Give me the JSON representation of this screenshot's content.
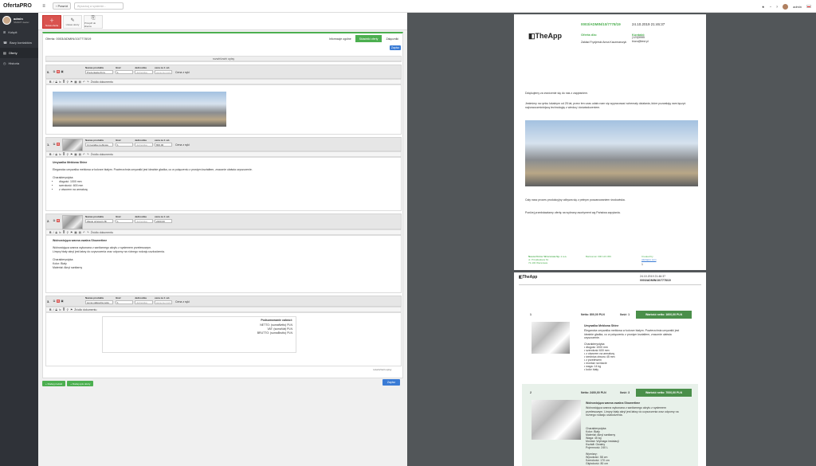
{
  "app": {
    "brand": "OfertaPRO",
    "back_label": "Powrót",
    "search_placeholder": "Wyszukaj w systemie...",
    "user_name": "admin"
  },
  "sidebar": {
    "user_name": "admin",
    "user_role": "SMART dealer",
    "items": [
      {
        "icon": "⊞",
        "label": "Kokpit"
      },
      {
        "icon": "☎",
        "label": "Bazy kontaktów"
      },
      {
        "icon": "▤",
        "label": "Oferty"
      },
      {
        "icon": "◷",
        "label": "Historia"
      }
    ]
  },
  "toolbar": {
    "buttons": [
      {
        "icon": "＋",
        "label": "Nowa oferta"
      },
      {
        "icon": "✎",
        "label": "Ustaw oferty"
      },
      {
        "icon": "⎘",
        "label": "Przejdź do klienta"
      }
    ]
  },
  "offer": {
    "header": "Oferta: 0003/ADMIN/10/7778/19",
    "tabs": [
      "Informacje ogólne",
      "Składniki oferty",
      "Załączniki"
    ],
    "save_label": "Zapisz",
    "rozwin_label": "rozwiń/zwiń opisy",
    "cena_label": "Cena z ręki",
    "field_labels": {
      "name": "Nazwa produktu",
      "qty": "Ilość",
      "unit": "Jednostka",
      "price": "cena za 1 szt."
    },
    "unit_placeholder": "Jednostka",
    "price_placeholder": "cena za 1 szt.",
    "source_label": "Źródło dokumentu",
    "products": [
      {
        "num": "0.",
        "name": "Prezentacja firmy",
        "qty": "1",
        "unit": "",
        "price": ""
      },
      {
        "num": "1.",
        "name": "Umywalka meblowa",
        "qty": "1",
        "unit": "",
        "price": "800,00"
      },
      {
        "num": "2.",
        "name": "Zlecaj grzewczy Bi",
        "qty": "1",
        "unit": "",
        "price": "2400,00"
      },
      {
        "num": "3.",
        "name": "suma całkowita netto",
        "qty": "1",
        "unit": "",
        "price": ""
      }
    ],
    "ed2": {
      "title": "Umywalka Meblowa Shine",
      "p": "Elegancka umywalka meblowa w kolorze białym. Powierzchnia umywalki jest idealnie gładka, co w połączeniu z prostym kształtem, znacznie ułatwia czyszczenie.",
      "char": "Charakterystyka:",
      "items": [
        "długość: 1000 mm",
        "szerokość: 600 mm",
        "z otworem na armaturę"
      ]
    },
    "ed3": {
      "title": "Wolnostojąca wanna owalna Showertime",
      "p1": "Wolnostojąca wanna wykonana z sanitarnego akrylu z systemem przelewowym.",
      "p2": "Limpry biały akryl jest łatwy do czyszczenia oraz odporny na różnego rodzaju uszkodzenia.",
      "c1": "Charakterystyka:",
      "c2": "Kolor: Biały",
      "c3": "Materiał: Akryl sanitarny"
    },
    "summary": {
      "title": "Podsumowanie całości:",
      "netto": "NETTO: (sumaNetto) PLN",
      "vat": "VAT: (sumaVat) PLN",
      "brutto": "BRUTTO: (sumaBrutto) PLN"
    },
    "add_product": "+ Dodaj produkt",
    "add_from_offer": "+ Dodaj opis oferty",
    "rozwin_bottom": "rozwiń/zwiń opisy",
    "save_bottom": "Zapisz"
  },
  "preview": {
    "number": "0003/ADMIN/10/7778/19",
    "date": "24.10.2019 21:46:37",
    "logo": "TheApp",
    "from_label": "Oferta dla:",
    "from_val": "Zakład Fryzjerski Anna Kaczmarczyk",
    "contact_label": "Kontakt:",
    "contact_phone": "(123)5555",
    "contact_email": "biuro@test.pl",
    "thanks": "Dziękujemy za zwrócenie się do nas z zapytaniem.",
    "intro": "Jesteśmy na rynku lokalnym od 25 lat, przez ten czas udało nam się wypracować schematy działania, które pozwalają nam łączyć najnowocześniejszą technologię z wiedzą i doświadczeniem.",
    "p1": "Cały nasz proces produkcyjny odbywa się z pełnym poszanowaniem środowiska.",
    "p2": "Poniżej przedstawiamy ofertę na wybrany asortyment wg Państwa zapytania.",
    "footer": {
      "c1a": "Nasza Firma: Wzorcowa Sp. z o.o.",
      "c1b": "ul. Przykładowa 61",
      "c1c": "72-100 Warszawa",
      "c2": "Bankomat: 000 123 456",
      "c3a": "Created by",
      "c3b": "ofertapro.com",
      "page": "1"
    },
    "p2date": "24.10.2019 21:46:37",
    "p2num": "0003/ADMIN/10/7778/19",
    "items": [
      {
        "n": "1",
        "netto": "Netto: 800,00 PLN",
        "ilosc": "Ilość: 1",
        "wart": "Wartość netto: 1600,00 PLN",
        "title": "Umywalka Meblowa Shine",
        "desc": "Elegancka umywalka meblowa w kolorze białym. Powierzchnia umywalki jest idealnie gładka, co w połączeniu z prostym kształtem, znacznie ułatwia czyszczenie.",
        "specs": [
          "Charakterystyka:",
          "• długość 1000 mm",
          "• szerokość 600 mm",
          "• z otworem na armaturę",
          "• średnica otworu 45 mm",
          "• z przelewem",
          "• montaż na blacie",
          "• waga: 14 kg",
          "• kolor biały"
        ]
      },
      {
        "n": "2",
        "netto": "Netto: 2400,00 PLN",
        "ilosc": "Ilość: 3",
        "wart": "Wartość netto: 7000,00 PLN",
        "title": "Wolnostojąca wanna owalna Showertime",
        "desc": "Wolnostojąca wanna wykonana z sanitarnego akrylu z systemem przelewowym. Limpry biały akryl jest łatwy do czyszczenia oraz odporny na różnego rodzaju uszkodzenia.",
        "specs": [
          "Charakterystyka:",
          "Kolor: Biały",
          "Materiał: Akryl sanitarny",
          "Waga: 45 kg",
          "Montaż: Wymaga instalacji",
          "Kształt: Owalny",
          "Pojemność: 240 L",
          "",
          "Wymiary:",
          "Wysokość: 58 cm",
          "Szerokość: 170 cm",
          "Głębokość: 80 cm"
        ]
      }
    ]
  },
  "colors": {
    "accent": "#4caf50",
    "sidebar": "#2f3238",
    "danger": "#d9534f",
    "primary": "#3a7bd5"
  }
}
